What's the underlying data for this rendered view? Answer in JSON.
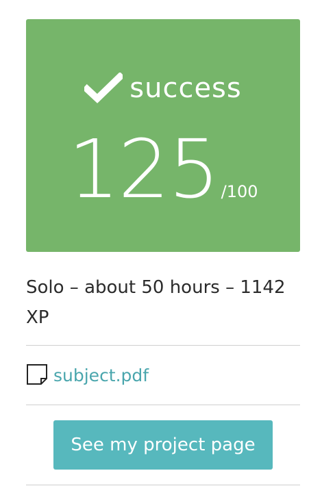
{
  "colors": {
    "success": "#76b56a",
    "accent": "#57b8bd",
    "link": "#4aa6ad",
    "divider": "#cfcfcf"
  },
  "status": {
    "icon": "check-icon",
    "label": "success"
  },
  "score": {
    "value": "125",
    "max": "/100"
  },
  "details": {
    "text": "Solo – about 50 hours – 1142 XP"
  },
  "attachment": {
    "icon": "file-icon",
    "name": "subject.pdf"
  },
  "actions": {
    "project_page_label": "See my project page"
  }
}
